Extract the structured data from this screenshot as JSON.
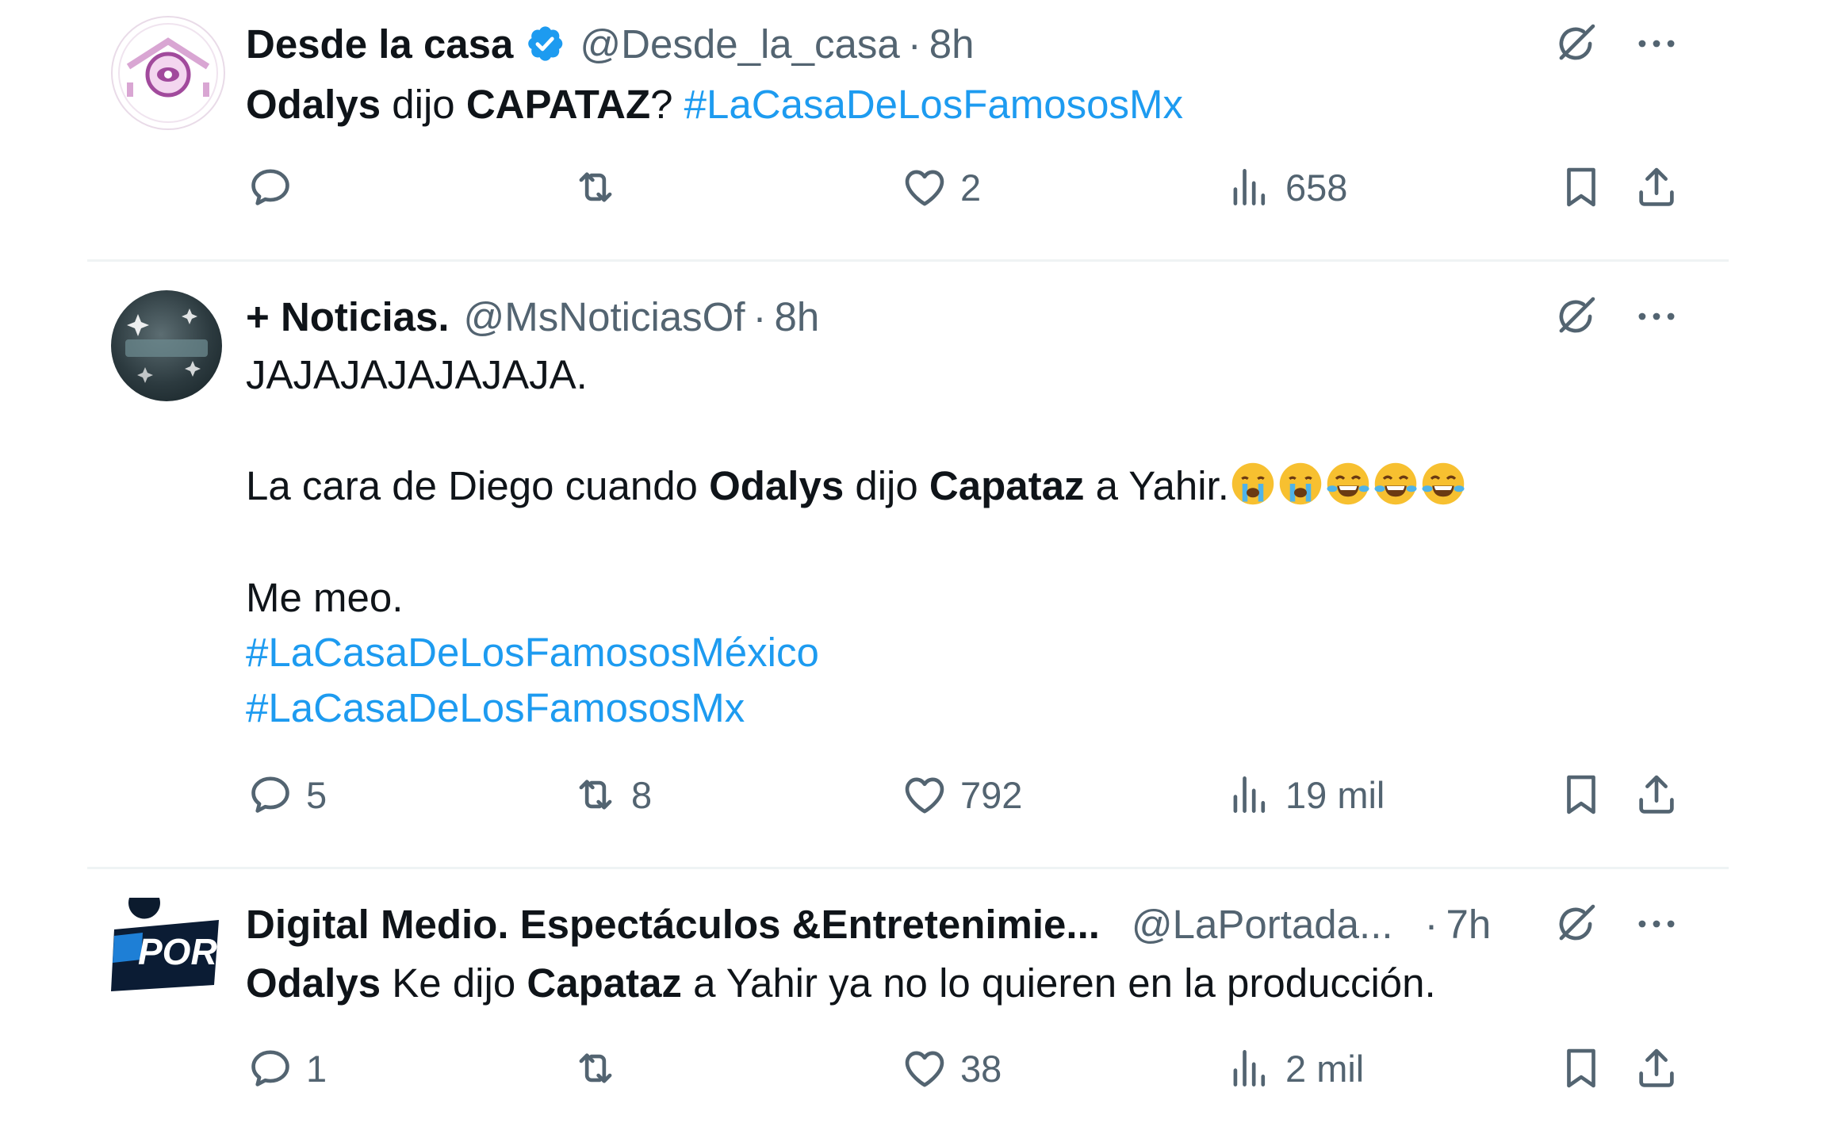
{
  "tweets": [
    {
      "display_name": "Desde la casa",
      "verified": true,
      "handle": "@Desde_la_casa",
      "time": "8h",
      "avatar_icon": "casa-logo-avatar",
      "text_parts": [
        {
          "t": "Odalys",
          "style": "bold"
        },
        {
          "t": " dijo ",
          "style": "normal"
        },
        {
          "t": "CAPATAZ",
          "style": "bold"
        },
        {
          "t": "? ",
          "style": "normal"
        },
        {
          "t": "#LaCasaDeLosFamososMx",
          "style": "hashtag"
        }
      ],
      "reply_count": "",
      "retweet_count": "",
      "like_count": "2",
      "view_count": "658"
    },
    {
      "display_name": "+ Noticias.",
      "verified": false,
      "handle": "@MsNoticiasOf",
      "time": "8h",
      "avatar_icon": "noticias-logo-avatar",
      "text_line_1": "JAJAJAJAJAJAJA.",
      "text_line_2_parts": [
        {
          "t": "La cara de Diego cuando ",
          "style": "normal"
        },
        {
          "t": "Odalys",
          "style": "bold"
        },
        {
          "t": " dijo ",
          "style": "normal"
        },
        {
          "t": "Capataz",
          "style": "bold"
        },
        {
          "t": " a Yahir.",
          "style": "normal"
        }
      ],
      "emojis": [
        "loudly-crying-face",
        "loudly-crying-face",
        "tears-of-joy-face",
        "tears-of-joy-face",
        "tears-of-joy-face"
      ],
      "text_line_3": "Me meo.",
      "hashtag_1": "#LaCasaDeLosFamososMéxico",
      "hashtag_2": "#LaCasaDeLosFamososMx",
      "reply_count": "5",
      "retweet_count": "8",
      "like_count": "792",
      "view_count": "19 mil"
    },
    {
      "display_name": "Digital Medio. Espectáculos &Entretenimie...",
      "verified": false,
      "handle": "@LaPortada...",
      "time": "7h",
      "avatar_icon": "la-portada-logo-avatar",
      "avatar_text": "POR",
      "text_parts": [
        {
          "t": "Odalys",
          "style": "bold"
        },
        {
          "t": " Ke dijo ",
          "style": "normal"
        },
        {
          "t": "Capataz",
          "style": "bold"
        },
        {
          "t": " a Yahir ya no lo quieren en la producción.",
          "style": "normal"
        }
      ],
      "reply_count": "1",
      "retweet_count": "",
      "like_count": "38",
      "view_count": "2 mil"
    }
  ],
  "colors": {
    "text": "#0f1419",
    "secondary": "#536471",
    "hashtag": "#1d9bf0",
    "verified": "#1d9bf0",
    "divider": "#eff3f4"
  },
  "icons": {
    "reply": "reply-icon",
    "retweet": "retweet-icon",
    "like": "heart-icon",
    "views": "views-icon",
    "bookmark": "bookmark-icon",
    "share": "share-icon",
    "grok": "grok-icon",
    "more": "more-icon"
  }
}
